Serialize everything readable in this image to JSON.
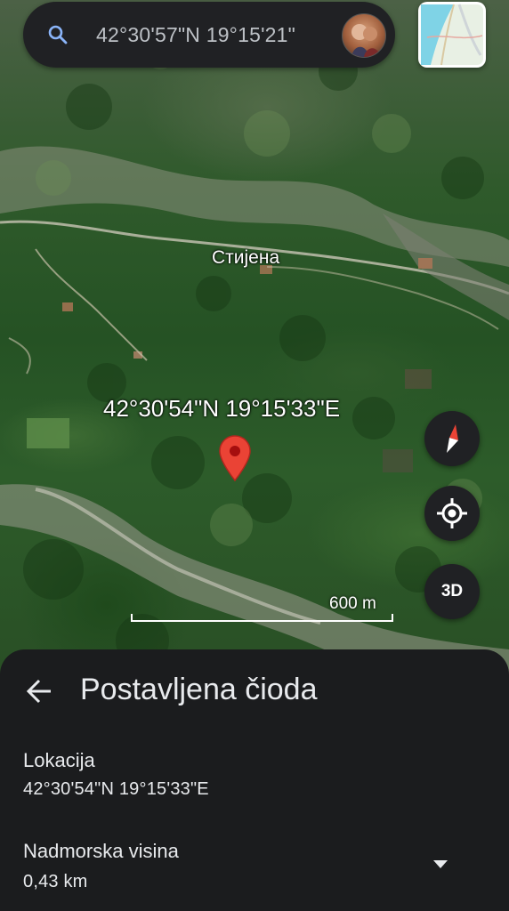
{
  "search": {
    "query": "42°30'57\"N 19°15'21\""
  },
  "map": {
    "place_label": "Стијена",
    "pin_coordinates": "42°30'54\"N 19°15'33\"E",
    "scale_label": "600 m",
    "button_3d_label": "3D"
  },
  "sheet": {
    "title": "Postavljena čioda",
    "location_label": "Lokacija",
    "location_value": "42°30'54\"N 19°15'33\"E",
    "elevation_label": "Nadmorska visina",
    "elevation_value": "0,43 km"
  },
  "icons": {
    "search": "search-icon",
    "avatar": "user-avatar",
    "layers": "map-layers-thumbnail",
    "pin": "map-pin-icon",
    "compass": "compass-icon",
    "locate": "my-location-icon",
    "back": "back-arrow-icon",
    "expand": "expand-triangle-icon"
  },
  "colors": {
    "pin_red": "#ea4335",
    "panel_bg": "#1b1c1e",
    "button_bg": "#202124",
    "text_primary": "#e8eaed"
  }
}
